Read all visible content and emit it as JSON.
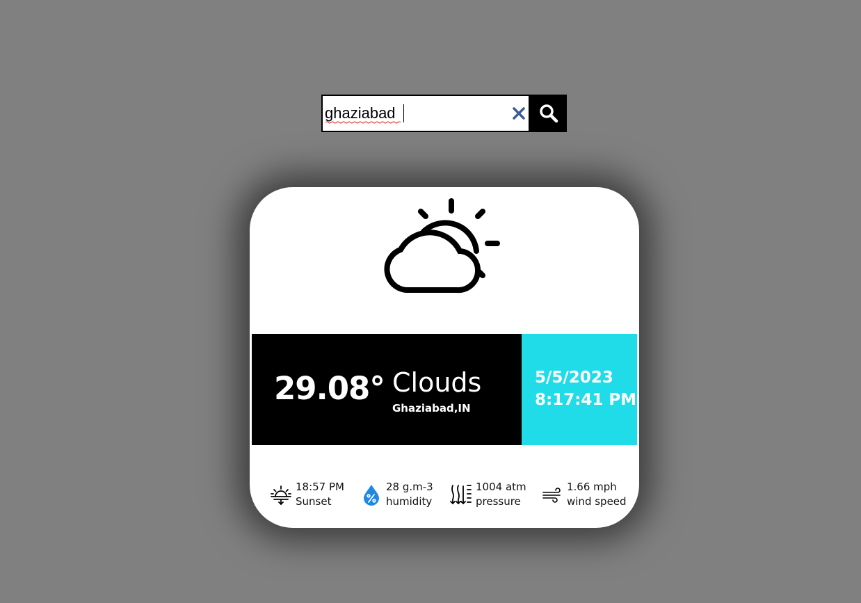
{
  "search": {
    "value": "ghaziabad",
    "clear_icon": "close-icon",
    "button_icon": "search-icon"
  },
  "weather": {
    "icon": "partly-cloudy-icon",
    "temperature": "29.08°",
    "condition": "Clouds",
    "location": "Ghaziabad,IN",
    "date": "5/5/2023",
    "time": "8:17:41 PM"
  },
  "stats": [
    {
      "icon": "sunset-icon",
      "value": "18:57 PM",
      "label": "Sunset"
    },
    {
      "icon": "humidity-icon",
      "value": "28 g.m-3",
      "label": "humidity"
    },
    {
      "icon": "pressure-icon",
      "value": "1004 atm",
      "label": "pressure"
    },
    {
      "icon": "wind-icon",
      "value": "1.66 mph",
      "label": "wind speed"
    }
  ],
  "colors": {
    "background": "#808080",
    "accent": "#1fdce8",
    "humidity_drop": "#1e88e5",
    "clear_icon": "#3a5a9a"
  }
}
